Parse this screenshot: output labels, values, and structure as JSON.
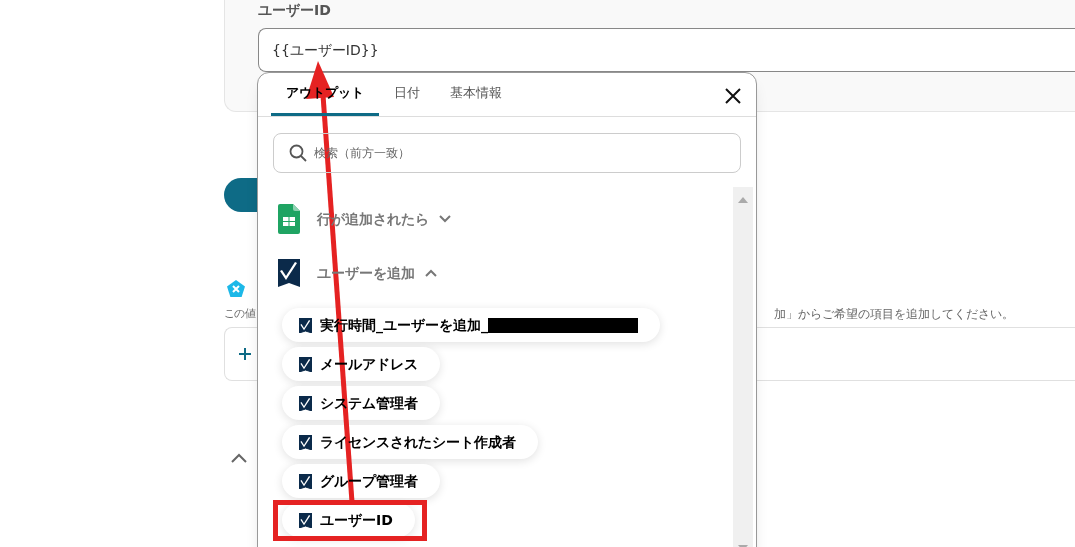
{
  "field": {
    "label": "ユーザーID",
    "value": "{{ユーザーID}}"
  },
  "description": {
    "start": "この値",
    "end": "加」からご希望の項目を追加してください。"
  },
  "popup": {
    "tabs": [
      {
        "label": "アウトプット",
        "selected": true
      },
      {
        "label": "日付",
        "selected": false
      },
      {
        "label": "基本情報",
        "selected": false
      }
    ],
    "search": {
      "placeholder": "検索（前方一致）"
    },
    "groups": [
      {
        "kind": "sheets",
        "title": "行が追加されたら",
        "expanded": false
      },
      {
        "kind": "smartsheet",
        "title": "ユーザーを追加",
        "expanded": true,
        "items": [
          {
            "label": "実行時間_ユーザーを追加_",
            "checked": true,
            "redacted": true
          },
          {
            "label": "メールアドレス",
            "checked": true,
            "redacted": false
          },
          {
            "label": "システム管理者",
            "checked": true,
            "redacted": false
          },
          {
            "label": "ライセンスされたシート作成者",
            "checked": true,
            "redacted": false
          },
          {
            "label": "グループ管理者",
            "checked": true,
            "redacted": false
          },
          {
            "label": "ユーザーID",
            "checked": true,
            "redacted": false
          }
        ]
      }
    ]
  }
}
